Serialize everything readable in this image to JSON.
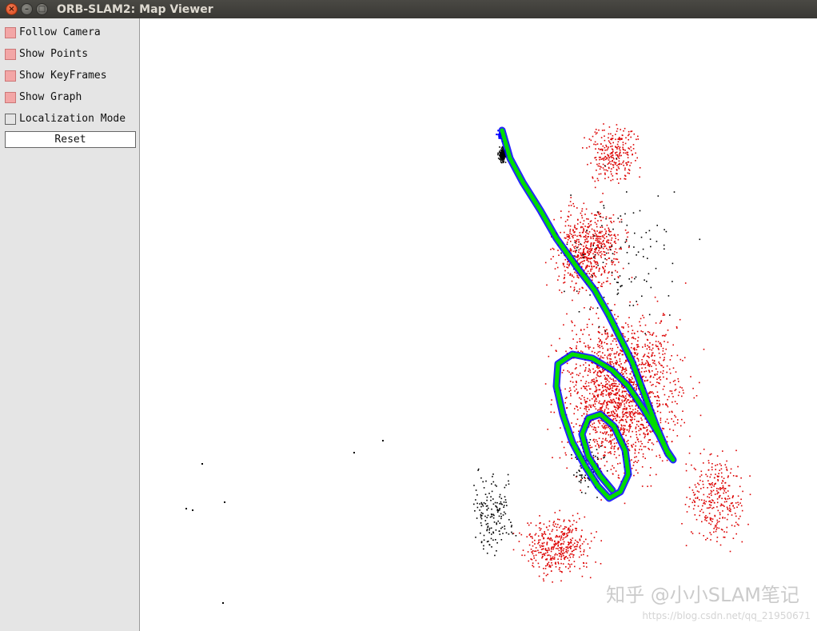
{
  "window": {
    "title": "ORB-SLAM2: Map Viewer",
    "close_glyph": "×",
    "minimize_glyph": "–",
    "maximize_glyph": "□"
  },
  "panel": {
    "options": [
      {
        "label": "Follow Camera",
        "checked": true
      },
      {
        "label": "Show Points",
        "checked": true
      },
      {
        "label": "Show KeyFrames",
        "checked": true
      },
      {
        "label": "Show Graph",
        "checked": true
      },
      {
        "label": "Localization Mode",
        "checked": false
      }
    ],
    "reset_label": "Reset"
  },
  "viewer": {
    "colors": {
      "map_points": "#dd0000",
      "reference_points": "#000000",
      "keyframes": "#0000ff",
      "graph": "#00dd00"
    }
  },
  "watermark": {
    "text": "知乎 @小小SLAM笔记",
    "subtext": "https://blog.csdn.net/qq_21950671"
  }
}
